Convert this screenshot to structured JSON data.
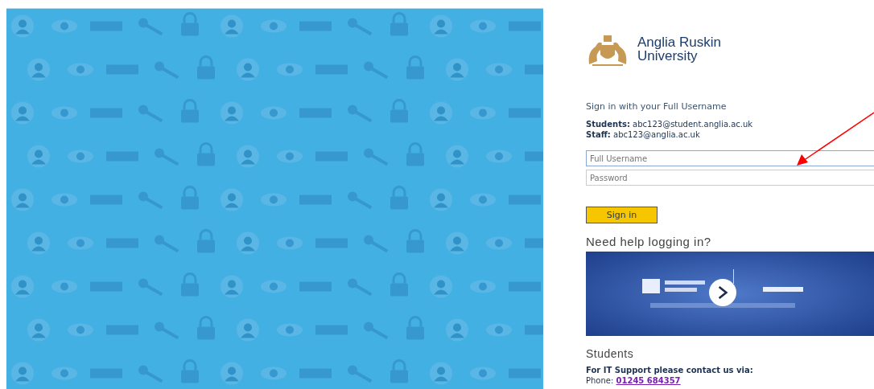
{
  "logo": {
    "lines": [
      "Anglia Ruskin",
      "University"
    ]
  },
  "sign_in": {
    "heading": "Sign in with your Full Username",
    "hints": [
      {
        "label": "Students:",
        "value": "abc123@student.anglia.ac.uk"
      },
      {
        "label": "Staff:",
        "value": "abc123@anglia.ac.uk"
      }
    ],
    "fields": [
      {
        "placeholder": "Full Username",
        "focused": true
      },
      {
        "placeholder": "Password",
        "focused": false
      }
    ],
    "button": "Sign in"
  },
  "help": {
    "heading": "Need help logging in?"
  },
  "support": {
    "heading": "Students",
    "contact": "For IT Support please contact us via:",
    "phone_label": "Phone:",
    "phone": "01245 684357"
  }
}
